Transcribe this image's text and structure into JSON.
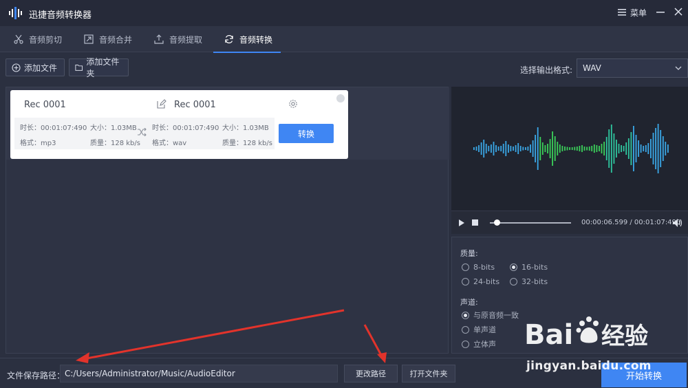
{
  "app": {
    "title": "迅捷音频转换器",
    "menu_label": "菜单"
  },
  "tabs": [
    {
      "label": "音频剪切",
      "icon": "scissors-icon"
    },
    {
      "label": "音频合并",
      "icon": "merge-icon"
    },
    {
      "label": "音频提取",
      "icon": "extract-icon"
    },
    {
      "label": "音频转换",
      "icon": "refresh-icon",
      "active": true
    }
  ],
  "toolbar": {
    "add_file": "添加文件",
    "add_folder": "添加文件夹",
    "format_label": "选择输出格式:",
    "format_value": "WAV"
  },
  "file_card": {
    "source_name": "Rec 0001",
    "target_name": "Rec 0001",
    "source": {
      "duration": "时长：00:01:07:490",
      "size": "大小：1.03MB",
      "format": "格式：mp3",
      "quality": "质量：128 kb/s"
    },
    "target": {
      "duration": "时长：00:01:07:490",
      "size": "大小：1.03MB",
      "format": "格式：wav",
      "quality": "质量：128 kb/s"
    },
    "convert_label": "转换"
  },
  "player": {
    "time": "00:00:06.599 / 00:01:07:490",
    "progress": 0.1
  },
  "settings": {
    "quality_title": "质量:",
    "quality_options": [
      "8-bits",
      "16-bits",
      "24-bits",
      "32-bits"
    ],
    "quality_selected": "16-bits",
    "channel_title": "声道:",
    "channel_options": [
      "与原音频一致",
      "单声道",
      "立体声"
    ],
    "channel_selected": "与原音频一致"
  },
  "bottom": {
    "path_label": "文件保存路径：",
    "path_value": "C:/Users/Administrator/Music/AudioEditor",
    "change_path": "更改路径",
    "open_folder": "打开文件夹",
    "start": "开始转换"
  },
  "watermark": {
    "brand": "Bai 经验",
    "url": "jingyan.baidu.com"
  },
  "colors": {
    "accent": "#3f86f3",
    "wave_green": "#3bd15a",
    "wave_blue": "#3aa8e8",
    "arrow": "#e2332b"
  }
}
